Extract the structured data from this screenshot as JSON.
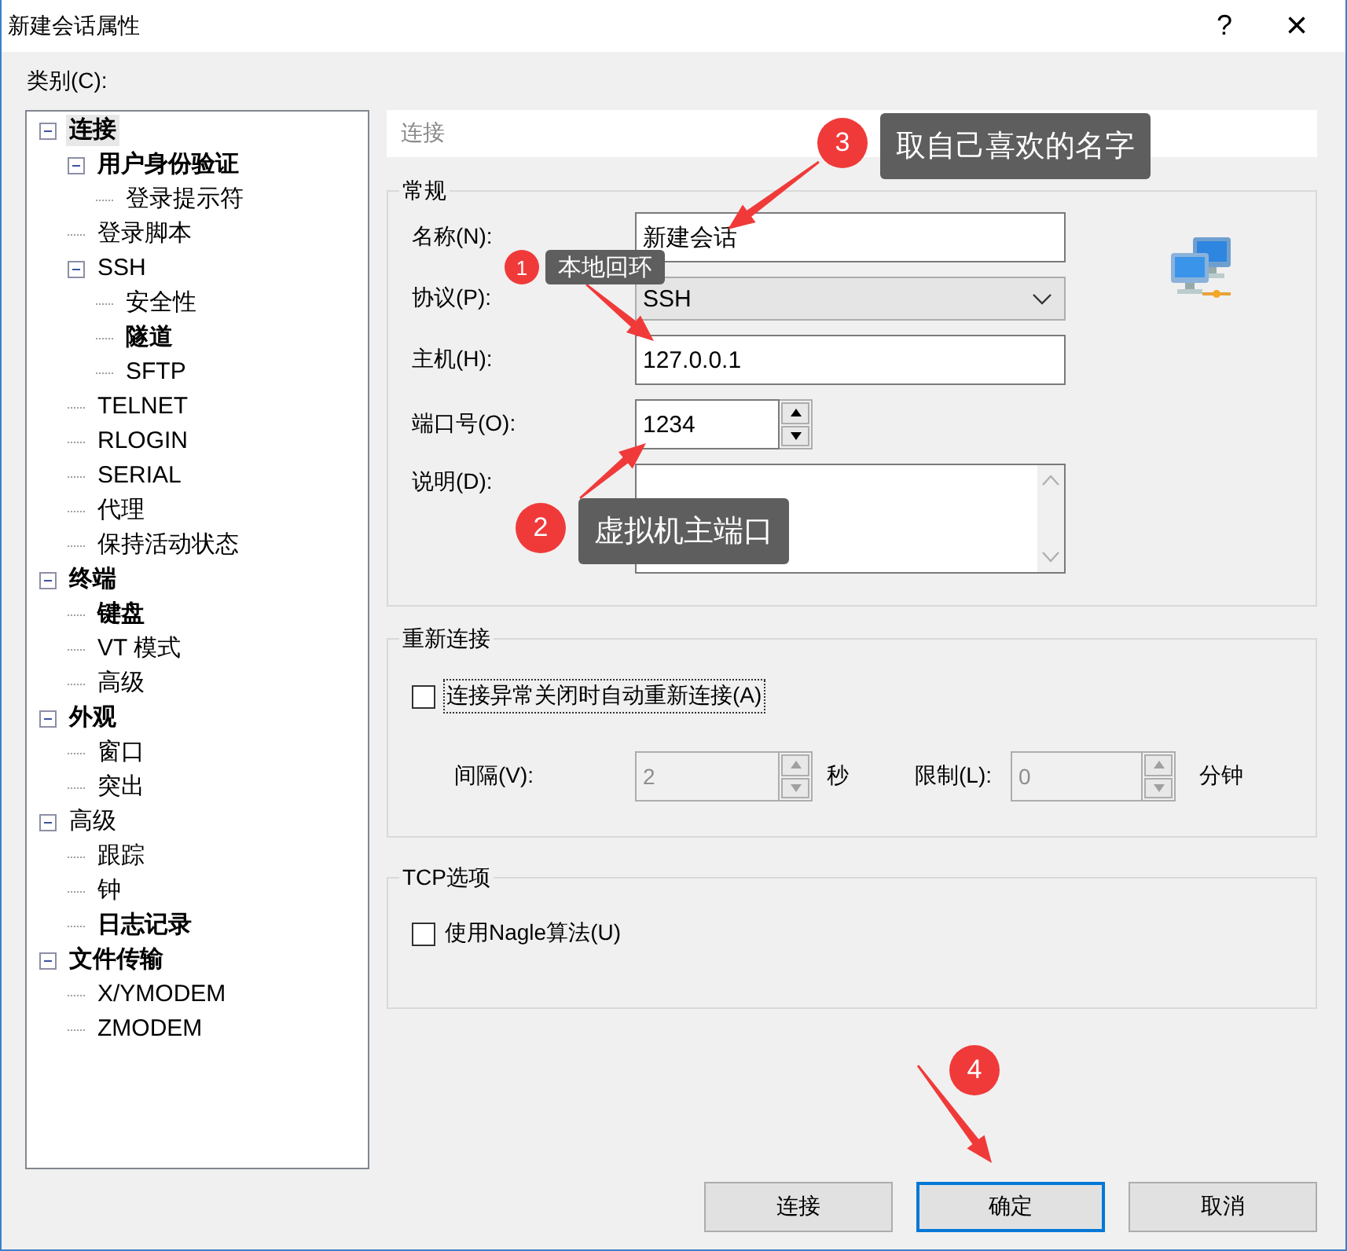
{
  "window": {
    "title": "新建会话属性",
    "help_button": "?",
    "close_button": "×"
  },
  "category_label": "类别(C):",
  "tree": [
    {
      "label": "连接",
      "bold": true,
      "selected": true,
      "expanded": true,
      "children": [
        {
          "label": "用户身份验证",
          "bold": true,
          "selected": false,
          "expanded": true,
          "children": [
            {
              "label": "登录提示符",
              "bold": false,
              "selected": false
            }
          ]
        },
        {
          "label": "登录脚本",
          "bold": false,
          "selected": false
        },
        {
          "label": "SSH",
          "bold": false,
          "selected": false,
          "expanded": true,
          "children": [
            {
              "label": "安全性",
              "bold": false,
              "selected": false
            },
            {
              "label": "隧道",
              "bold": true,
              "selected": false
            },
            {
              "label": "SFTP",
              "bold": false,
              "selected": false
            }
          ]
        },
        {
          "label": "TELNET",
          "bold": false,
          "selected": false
        },
        {
          "label": "RLOGIN",
          "bold": false,
          "selected": false
        },
        {
          "label": "SERIAL",
          "bold": false,
          "selected": false
        },
        {
          "label": "代理",
          "bold": false,
          "selected": false
        },
        {
          "label": "保持活动状态",
          "bold": false,
          "selected": false
        }
      ]
    },
    {
      "label": "终端",
      "bold": true,
      "selected": false,
      "expanded": true,
      "children": [
        {
          "label": "键盘",
          "bold": true,
          "selected": false
        },
        {
          "label": "VT 模式",
          "bold": false,
          "selected": false
        },
        {
          "label": "高级",
          "bold": false,
          "selected": false
        }
      ]
    },
    {
      "label": "外观",
      "bold": true,
      "selected": false,
      "expanded": true,
      "children": [
        {
          "label": "窗口",
          "bold": false,
          "selected": false
        },
        {
          "label": "突出",
          "bold": false,
          "selected": false
        }
      ]
    },
    {
      "label": "高级",
      "bold": false,
      "selected": false,
      "expanded": true,
      "children": [
        {
          "label": "跟踪",
          "bold": false,
          "selected": false
        },
        {
          "label": "钟",
          "bold": false,
          "selected": false
        },
        {
          "label": "日志记录",
          "bold": true,
          "selected": false
        }
      ]
    },
    {
      "label": "文件传输",
      "bold": true,
      "selected": false,
      "expanded": true,
      "children": [
        {
          "label": "X/YMODEM",
          "bold": false,
          "selected": false
        },
        {
          "label": "ZMODEM",
          "bold": false,
          "selected": false
        }
      ]
    }
  ],
  "panel": {
    "header": "连接",
    "general": {
      "title": "常规",
      "fields": [
        {
          "kind": "text",
          "label": "名称(N):",
          "value": "新建会话"
        },
        {
          "kind": "dropdown",
          "label": "协议(P):",
          "value": "SSH"
        },
        {
          "kind": "text",
          "label": "主机(H):",
          "value": "127.0.0.1"
        },
        {
          "kind": "spin",
          "label": "端口号(O):",
          "value": "1234",
          "disabled": false
        },
        {
          "kind": "textarea",
          "label": "说明(D):"
        }
      ]
    },
    "reconnect": {
      "title": "重新连接",
      "checkbox": {
        "label": "连接异常关闭时自动重新连接(A)",
        "checked": false
      },
      "interval": {
        "label": "间隔(V):",
        "value": "2",
        "unit": "秒",
        "disabled": true
      },
      "limit": {
        "label": "限制(L):",
        "value": "0",
        "unit": "分钟",
        "disabled": true
      }
    },
    "tcp": {
      "title": "TCP选项",
      "checkbox": {
        "label": "使用Nagle算法(U)",
        "checked": false
      }
    }
  },
  "buttons": [
    {
      "label": "连接",
      "default": false
    },
    {
      "label": "确定",
      "default": true
    },
    {
      "label": "取消",
      "default": false
    }
  ],
  "annotations": [
    {
      "number": "3",
      "text": "取自己喜欢的名字"
    },
    {
      "number": "1",
      "text": "本地回环"
    },
    {
      "number": "2",
      "text": "虚拟机主端口"
    },
    {
      "number": "4"
    }
  ]
}
